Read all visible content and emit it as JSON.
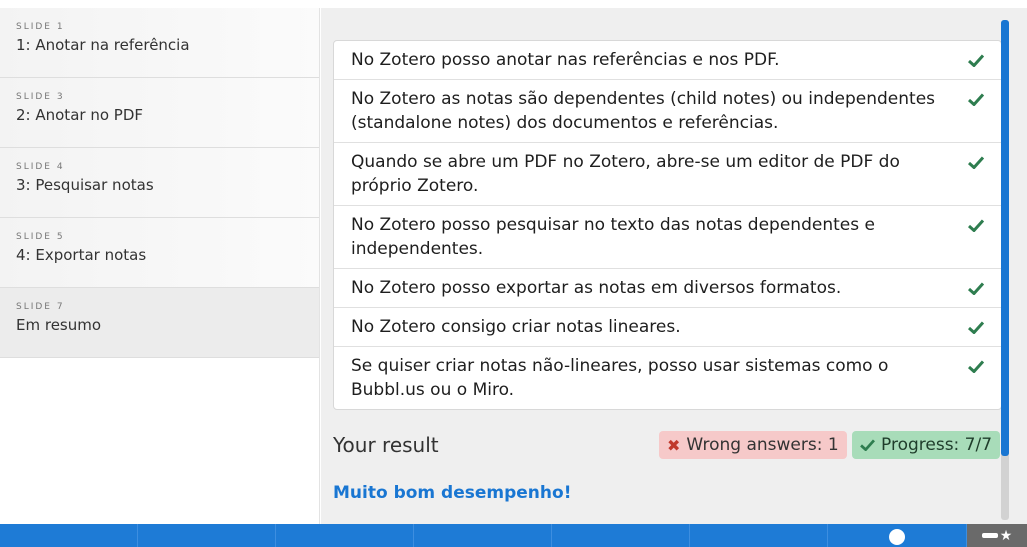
{
  "sidebar": {
    "items": [
      {
        "slide": "SLIDE 1",
        "title": "1: Anotar na referência"
      },
      {
        "slide": "SLIDE 3",
        "title": "2: Anotar no PDF"
      },
      {
        "slide": "SLIDE 4",
        "title": "3: Pesquisar notas"
      },
      {
        "slide": "SLIDE 5",
        "title": "4: Exportar notas"
      },
      {
        "slide": "SLIDE 7",
        "title": "Em resumo"
      }
    ]
  },
  "main": {
    "answers": [
      "No Zotero posso anotar nas referências e nos PDF.",
      "No Zotero as notas são dependentes (child notes) ou independentes (standalone notes) dos documentos e referências.",
      "Quando se abre um PDF no Zotero, abre-se um editor de PDF do próprio Zotero.",
      "No Zotero posso pesquisar no texto das notas dependentes e independentes.",
      "No Zotero posso exportar as notas em diversos formatos.",
      "No Zotero consigo criar notas lineares.",
      "Se quiser criar notas não-lineares, posso usar sistemas como o Bubbl.us ou o Miro."
    ],
    "result_label": "Your result",
    "wrong_badge": "Wrong answers: 1",
    "progress_badge": "Progress: 7/7",
    "feedback": "Muito bom desempenho!"
  },
  "colors": {
    "accent": "#1976d2",
    "check": "#2e7d4f",
    "wrong_bg": "#f6c9c9",
    "progress_bg": "#a8dcb9"
  },
  "icons": {
    "answer_mark": "check-icon",
    "wrong_mark": "cross-icon",
    "progress_mark": "check-icon"
  }
}
